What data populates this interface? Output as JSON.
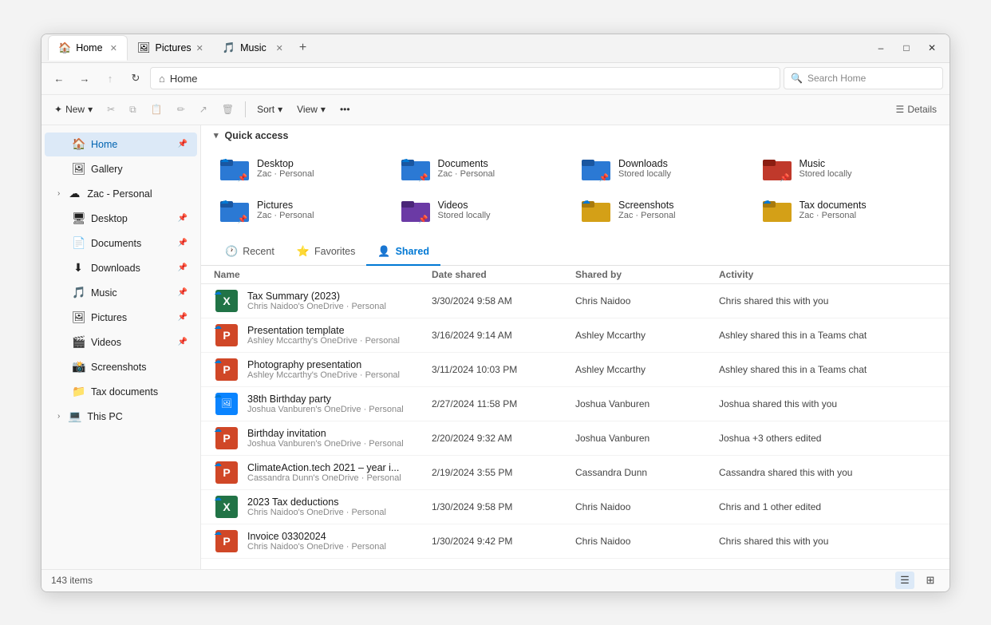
{
  "window": {
    "tabs": [
      {
        "label": "Home",
        "icon": "🏠",
        "color": "#555",
        "active": true
      },
      {
        "label": "Pictures",
        "icon": "🖼",
        "color": "#2b79d4",
        "active": false
      },
      {
        "label": "Music",
        "icon": "🎵",
        "color": "#c0392b",
        "active": false
      }
    ],
    "new_tab_title": "+",
    "minimize": "–",
    "maximize": "□",
    "close": "✕"
  },
  "addressbar": {
    "back": "←",
    "forward": "→",
    "up": "↑",
    "refresh": "↻",
    "home_icon": "⌂",
    "chevron": "›",
    "path": "Home",
    "search_placeholder": "Search Home"
  },
  "toolbar": {
    "new_label": "New",
    "new_arrow": "▾",
    "cut_icon": "✂",
    "copy_icon": "⧉",
    "paste_icon": "📋",
    "rename_icon": "✏",
    "share_icon": "↗",
    "delete_icon": "🗑",
    "sort_label": "Sort",
    "sort_arrow": "▾",
    "view_label": "View",
    "view_arrow": "▾",
    "more_icon": "•••",
    "details_label": "Details"
  },
  "sidebar": {
    "items": [
      {
        "id": "home",
        "label": "Home",
        "icon": "🏠",
        "active": true,
        "pin": true
      },
      {
        "id": "gallery",
        "label": "Gallery",
        "icon": "🖼",
        "active": false,
        "pin": false
      },
      {
        "id": "zac-personal",
        "label": "Zac - Personal",
        "icon": "☁",
        "active": false,
        "expandable": true
      },
      {
        "id": "desktop",
        "label": "Desktop",
        "icon": "🖥",
        "active": false,
        "pin": true
      },
      {
        "id": "documents",
        "label": "Documents",
        "icon": "📄",
        "active": false,
        "pin": true
      },
      {
        "id": "downloads",
        "label": "Downloads",
        "icon": "⬇",
        "active": false,
        "pin": true
      },
      {
        "id": "music",
        "label": "Music",
        "icon": "🎵",
        "active": false,
        "pin": true
      },
      {
        "id": "pictures",
        "label": "Pictures",
        "icon": "🖼",
        "active": false,
        "pin": true
      },
      {
        "id": "videos",
        "label": "Videos",
        "icon": "🎬",
        "active": false,
        "pin": true
      },
      {
        "id": "screenshots",
        "label": "Screenshots",
        "icon": "📸",
        "active": false,
        "pin": false
      },
      {
        "id": "tax-documents",
        "label": "Tax documents",
        "icon": "📁",
        "active": false,
        "pin": false
      },
      {
        "id": "this-pc",
        "label": "This PC",
        "icon": "💻",
        "active": false,
        "expandable": true
      }
    ]
  },
  "quick_access": {
    "title": "Quick access",
    "items": [
      {
        "name": "Desktop",
        "sub": "Zac · Personal",
        "folder_color": "#2b79d4",
        "pinned": true,
        "cloud": true
      },
      {
        "name": "Documents",
        "sub": "Zac · Personal",
        "folder_color": "#2b79d4",
        "pinned": true,
        "cloud": true
      },
      {
        "name": "Downloads",
        "sub": "Stored locally",
        "folder_color": "#2b79d4",
        "pinned": true,
        "cloud": false
      },
      {
        "name": "Music",
        "sub": "Stored locally",
        "folder_color": "#c0392b",
        "pinned": true,
        "cloud": false
      },
      {
        "name": "Pictures",
        "sub": "Zac · Personal",
        "folder_color": "#2b79d4",
        "pinned": true,
        "cloud": true
      },
      {
        "name": "Videos",
        "sub": "Stored locally",
        "folder_color": "#6b3aa5",
        "pinned": true,
        "cloud": false
      },
      {
        "name": "Screenshots",
        "sub": "Zac · Personal",
        "folder_color": "#d4a017",
        "pinned": false,
        "cloud": true
      },
      {
        "name": "Tax documents",
        "sub": "Zac · Personal",
        "folder_color": "#d4a017",
        "pinned": false,
        "cloud": true
      }
    ]
  },
  "content_tabs": [
    {
      "id": "recent",
      "label": "Recent",
      "icon": "🕐",
      "active": false
    },
    {
      "id": "favorites",
      "label": "Favorites",
      "icon": "⭐",
      "active": false
    },
    {
      "id": "shared",
      "label": "Shared",
      "icon": "👤",
      "active": true
    }
  ],
  "file_list": {
    "headers": [
      "Name",
      "Date shared",
      "Shared by",
      "Activity"
    ],
    "rows": [
      {
        "name": "Tax Summary (2023)",
        "sub": "Chris Naidoo's OneDrive · Personal",
        "date": "3/30/2024 9:58 AM",
        "shared_by": "Chris Naidoo",
        "activity": "Chris shared this with you",
        "type": "excel",
        "cloud": true
      },
      {
        "name": "Presentation template",
        "sub": "Ashley Mccarthy's OneDrive · Personal",
        "date": "3/16/2024 9:14 AM",
        "shared_by": "Ashley Mccarthy",
        "activity": "Ashley shared this in a Teams chat",
        "type": "ppt",
        "cloud": true
      },
      {
        "name": "Photography presentation",
        "sub": "Ashley Mccarthy's OneDrive · Personal",
        "date": "3/11/2024 10:03 PM",
        "shared_by": "Ashley Mccarthy",
        "activity": "Ashley shared this in a Teams chat",
        "type": "ppt",
        "cloud": true
      },
      {
        "name": "38th Birthday party",
        "sub": "Joshua Vanburen's OneDrive · Personal",
        "date": "2/27/2024 11:58 PM",
        "shared_by": "Joshua Vanburen",
        "activity": "Joshua shared this with you",
        "type": "img",
        "cloud": true
      },
      {
        "name": "Birthday invitation",
        "sub": "Joshua Vanburen's OneDrive · Personal",
        "date": "2/20/2024 9:32 AM",
        "shared_by": "Joshua Vanburen",
        "activity": "Joshua +3 others edited",
        "type": "ppt",
        "cloud": true
      },
      {
        "name": "ClimateAction.tech 2021 – year i...",
        "sub": "Cassandra Dunn's OneDrive · Personal",
        "date": "2/19/2024 3:55 PM",
        "shared_by": "Cassandra Dunn",
        "activity": "Cassandra shared this with you",
        "type": "ppt",
        "cloud": true
      },
      {
        "name": "2023 Tax deductions",
        "sub": "Chris Naidoo's OneDrive · Personal",
        "date": "1/30/2024 9:58 PM",
        "shared_by": "Chris Naidoo",
        "activity": "Chris and 1 other edited",
        "type": "excel",
        "cloud": true
      },
      {
        "name": "Invoice 03302024",
        "sub": "Chris Naidoo's OneDrive · Personal",
        "date": "1/30/2024 9:42 PM",
        "shared_by": "Chris Naidoo",
        "activity": "Chris shared this with you",
        "type": "ppt",
        "cloud": true
      }
    ]
  },
  "statusbar": {
    "count": "143 items",
    "view_list": "☰",
    "view_grid": "⊞"
  }
}
